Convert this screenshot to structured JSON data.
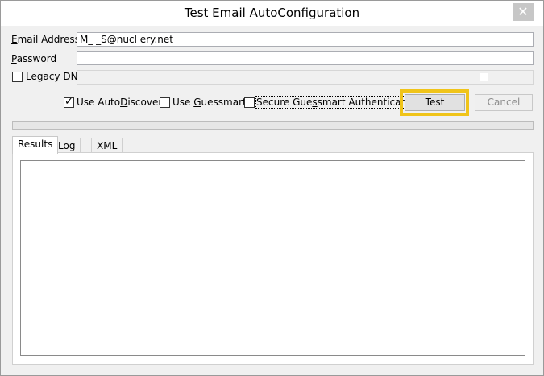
{
  "window": {
    "title": "Test Email AutoConfiguration",
    "close_glyph": "✕"
  },
  "form": {
    "email_label_pre": "",
    "email_label_u": "E",
    "email_label_post": "mail Address",
    "email_value": "M_ _S@nucl            ery.net",
    "password_label_u": "P",
    "password_label_post": "assword",
    "password_value": "",
    "legacy_dn_label_u": "L",
    "legacy_dn_label_post": "egacy DN",
    "legacy_dn_checked": false
  },
  "options": {
    "autodiscover": {
      "pre": "Use Auto",
      "u": "D",
      "post": "iscover",
      "checked": true
    },
    "guessmart": {
      "pre": "Use ",
      "u": "G",
      "post": "uessmart",
      "checked": false
    },
    "secure_guessmart": {
      "pre": "Secure Gue",
      "u": "s",
      "post": "smart Authentication",
      "checked": false
    },
    "check_glyph": "✓"
  },
  "buttons": {
    "test": "Test",
    "cancel": "Cancel"
  },
  "progress": {
    "value": 0
  },
  "tabs": [
    {
      "label": "Results",
      "active": true
    },
    {
      "label": "Log",
      "active": false
    },
    {
      "label": "XML",
      "active": false
    }
  ],
  "results": {
    "content": ""
  },
  "colors": {
    "highlight": "#f0c419",
    "progress": "#06b025"
  }
}
